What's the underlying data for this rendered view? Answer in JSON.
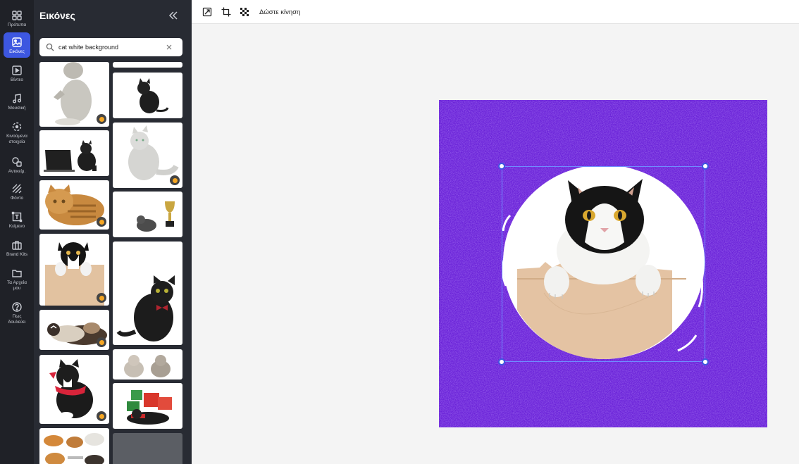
{
  "rail": {
    "items": [
      {
        "label": "Πρότυπα",
        "icon": "templates-icon"
      },
      {
        "label": "Εικόνες",
        "icon": "image-icon",
        "active": true
      },
      {
        "label": "Βίντεο",
        "icon": "video-icon"
      },
      {
        "label": "Μουσική",
        "icon": "music-icon"
      },
      {
        "label": "Κινούμενα\nστοιχεία",
        "icon": "animated-elements-icon"
      },
      {
        "label": "Αντικείμ.",
        "icon": "shapes-icon"
      },
      {
        "label": "Φόντο",
        "icon": "background-icon"
      },
      {
        "label": "Κείμενο",
        "icon": "text-icon"
      },
      {
        "label": "Brand Kits",
        "icon": "briefcase-icon"
      },
      {
        "label": "Τα Αρχεία\nμου",
        "icon": "folder-icon"
      },
      {
        "label": "Πως\nδουλεύει",
        "icon": "help-icon"
      }
    ]
  },
  "panel": {
    "title": "Εικόνες",
    "collapse_icon": "double-chevron-left-icon",
    "search": {
      "value": "cat white background",
      "placeholder": "",
      "icon": "search-icon",
      "clear_icon": "close-icon"
    }
  },
  "toolbar": {
    "animate_label": "Δώστε κίνηση",
    "buttons": [
      "resize-icon",
      "crop-icon",
      "transparency-icon"
    ]
  },
  "colors": {
    "rail_bg": "#1f2127",
    "panel_bg": "#282b33",
    "accent": "#3d57e0",
    "canvas_bg": "#6a22d8",
    "selection": "#6f8cff",
    "premium_badge": "#f5a623"
  }
}
